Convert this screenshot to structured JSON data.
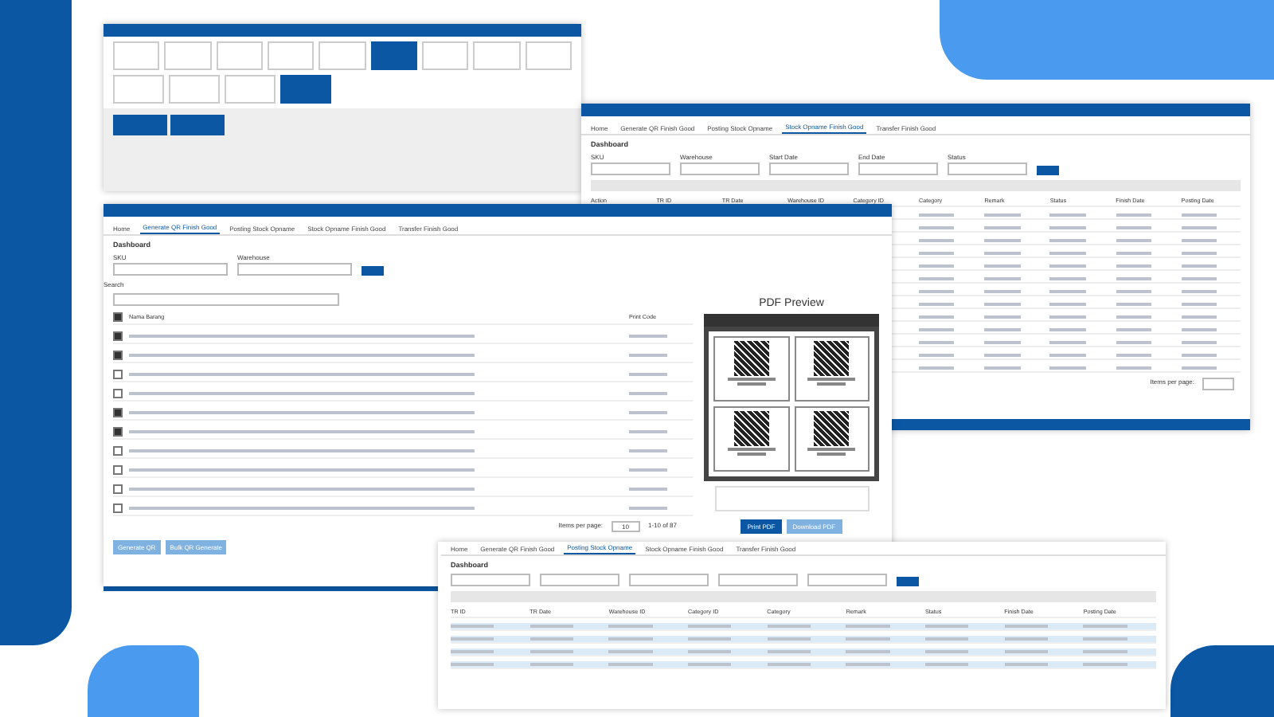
{
  "top_window": {
    "tiles": [
      {
        "selected": false
      },
      {
        "selected": false
      },
      {
        "selected": false
      },
      {
        "selected": false
      },
      {
        "selected": false
      },
      {
        "selected": true
      },
      {
        "selected": false
      },
      {
        "selected": false
      },
      {
        "selected": false
      }
    ],
    "tiles_2": [
      {
        "selected": false
      },
      {
        "selected": false
      },
      {
        "selected": false
      },
      {
        "selected": true
      }
    ],
    "cards": [
      {
        "selected": true
      },
      {
        "selected": true
      }
    ]
  },
  "right_window": {
    "tabs": [
      {
        "label": "Home",
        "selected": false
      },
      {
        "label": "Generate QR Finish Good",
        "selected": false
      },
      {
        "label": "Posting Stock Opname",
        "selected": false
      },
      {
        "label": "Stock Opname Finish Good",
        "selected": true
      },
      {
        "label": "Transfer Finish Good",
        "selected": false
      }
    ],
    "breadcrumb": "Dashboard",
    "filters": [
      "SKU",
      "Warehouse",
      "Start Date",
      "End Date",
      "Status"
    ],
    "columns": [
      "Action",
      "TR ID",
      "TR Date",
      "Warehouse ID",
      "Category ID",
      "Category",
      "Remark",
      "Status",
      "Finish Date",
      "Posting Date"
    ],
    "rows": [
      {},
      {},
      {},
      {},
      {},
      {},
      {},
      {},
      {},
      {},
      {},
      {},
      {}
    ],
    "pager_label": "Items per page:"
  },
  "front_window": {
    "tabs": [
      {
        "label": "Home",
        "selected": false
      },
      {
        "label": "Generate QR Finish Good",
        "selected": true
      },
      {
        "label": "Posting Stock Opname",
        "selected": false
      },
      {
        "label": "Stock Opname Finish Good",
        "selected": false
      },
      {
        "label": "Transfer Finish Good",
        "selected": false
      }
    ],
    "breadcrumb": "Dashboard",
    "fields": [
      "SKU",
      "Warehouse"
    ],
    "search_label": "Search",
    "columns": [
      "Nama Barang",
      "Print Code"
    ],
    "rows": [
      {
        "checked": true
      },
      {
        "checked": true
      },
      {
        "checked": false
      },
      {
        "checked": false
      },
      {
        "checked": true
      },
      {
        "checked": true
      },
      {
        "checked": false
      },
      {
        "checked": false
      },
      {
        "checked": false
      },
      {
        "checked": false
      }
    ],
    "pager": {
      "label": "Items per page:",
      "size": "10",
      "range": "1-10 of 87"
    },
    "buttons": [
      "Generate QR",
      "Bulk QR Generate"
    ],
    "pdf_dialog": {
      "title": "PDF Preview",
      "buttons": [
        "Print PDF",
        "Download PDF"
      ]
    },
    "header_checked": true
  },
  "bottom_window": {
    "tabs": [
      {
        "label": "Home",
        "selected": false
      },
      {
        "label": "Generate QR Finish Good",
        "selected": false
      },
      {
        "label": "Posting Stock Opname",
        "selected": true
      },
      {
        "label": "Stock Opname Finish Good",
        "selected": false
      },
      {
        "label": "Transfer Finish Good",
        "selected": false
      }
    ],
    "breadcrumb": "Dashboard",
    "columns": [
      "TR ID",
      "TR Date",
      "Warehouse ID",
      "Category ID",
      "Category",
      "Remark",
      "Status",
      "Finish Date",
      "Posting Date"
    ],
    "rows": [
      {},
      {},
      {},
      {}
    ]
  }
}
